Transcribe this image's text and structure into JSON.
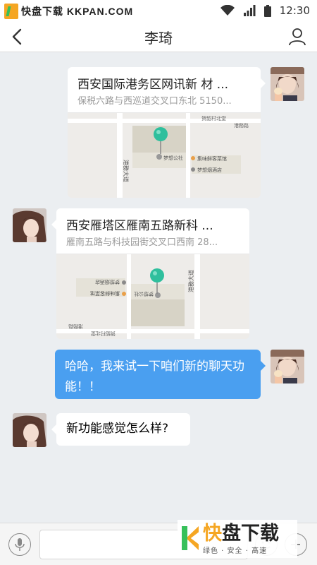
{
  "status_bar": {
    "watermark": "快盘下载 KKPAN.COM",
    "time": "12:30"
  },
  "header": {
    "title": "李琦"
  },
  "messages": [
    {
      "direction": "out",
      "type": "location",
      "title": "西安国际港务区网讯新 材 ...",
      "address": "保税六路与西巡道交叉口东北 5150...",
      "map_labels": [
        "贺韶村北堂",
        "港務路",
        "港務大道",
        "梦想公社",
        "集味鲜客菜馆",
        "梦想烟酒店"
      ]
    },
    {
      "direction": "in",
      "type": "location",
      "title": "西安雁塔区雁南五路新科 ...",
      "address": "雁南五路与科技园街交叉口西南 28...",
      "map_labels": [
        "贺韶村北堂",
        "港務路",
        "港務大道",
        "梦想公社",
        "集味鲜客菜馆",
        "梦想烟酒店"
      ]
    },
    {
      "direction": "out",
      "type": "text",
      "text": "哈哈，我来试一下咱们新的聊天功能！！"
    },
    {
      "direction": "in",
      "type": "text",
      "text": "新功能感觉怎么样?"
    }
  ],
  "input_bar": {
    "placeholder": ""
  },
  "brand": {
    "main_1": "快",
    "main_2": "盘下载",
    "tagline": "绿色 · 安全 · 高速"
  },
  "colors": {
    "accent_blue": "#4a9ff0",
    "pin_teal": "#2fbf9d",
    "background": "#ebeef1"
  }
}
